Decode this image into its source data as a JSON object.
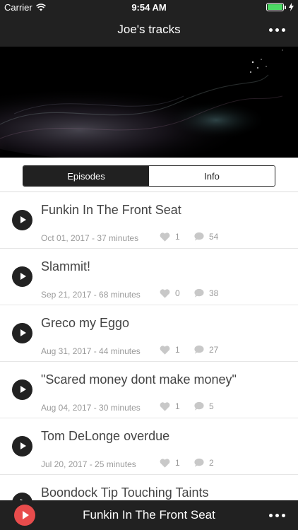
{
  "status": {
    "carrier": "Carrier",
    "time": "9:54 AM"
  },
  "nav": {
    "title": "Joe's tracks"
  },
  "tabs": [
    {
      "label": "Episodes",
      "active": true
    },
    {
      "label": "Info",
      "active": false
    }
  ],
  "episodes": [
    {
      "title": "Funkin In The Front Seat",
      "meta": "Oct 01, 2017 - 37 minutes",
      "likes": "1",
      "comments": "54"
    },
    {
      "title": "Slammit!",
      "meta": "Sep 21, 2017 - 68 minutes",
      "likes": "0",
      "comments": "38"
    },
    {
      "title": "Greco my Eggo",
      "meta": "Aug 31, 2017 - 44 minutes",
      "likes": "1",
      "comments": "27"
    },
    {
      "title": "\"Scared money dont make money\"",
      "meta": "Aug 04, 2017 - 30 minutes",
      "likes": "1",
      "comments": "5"
    },
    {
      "title": "Tom DeLonge overdue",
      "meta": "Jul 20, 2017 - 25 minutes",
      "likes": "1",
      "comments": "2"
    },
    {
      "title": "Boondock Tip Touching Taints",
      "meta": "",
      "likes": "",
      "comments": ""
    }
  ],
  "player": {
    "title": "Funkin In The Front Seat"
  },
  "colors": {
    "bar": "#212121",
    "accent": "#e84c4c",
    "battery": "#4cd964"
  }
}
